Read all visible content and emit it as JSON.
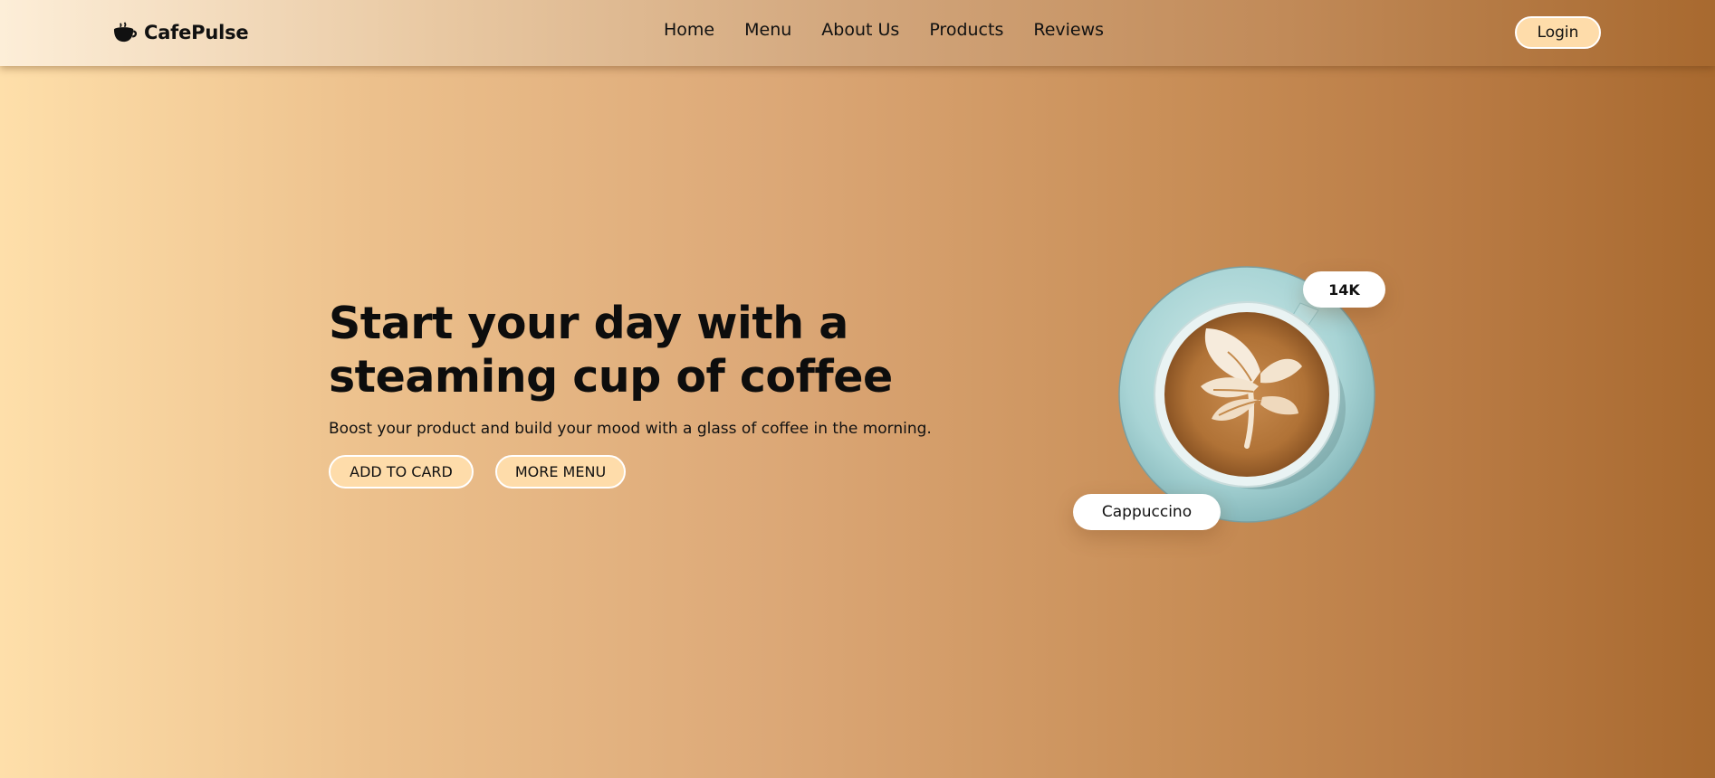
{
  "brand": {
    "name": "CafePulse",
    "icon": "coffee-cup-icon"
  },
  "nav": {
    "items": [
      {
        "label": "Home"
      },
      {
        "label": "Menu"
      },
      {
        "label": "About Us"
      },
      {
        "label": "Products"
      },
      {
        "label": "Reviews"
      }
    ],
    "login_label": "Login"
  },
  "hero": {
    "title": "Start your day with a steaming cup of coffee",
    "subtitle": "Boost your product and build your mood with a glass of coffee in the morning.",
    "add_to_card_label": "ADD TO CARD",
    "more_menu_label": "MORE MENU"
  },
  "product_card": {
    "likes": "14K",
    "name": "Cappuccino",
    "image": "cappuccino-latte-art-image"
  },
  "colors": {
    "button_fill": "#fedcaa",
    "background_start": "#fedfaa",
    "background_end": "#a8692f",
    "saucer": "#a8d4d5"
  }
}
